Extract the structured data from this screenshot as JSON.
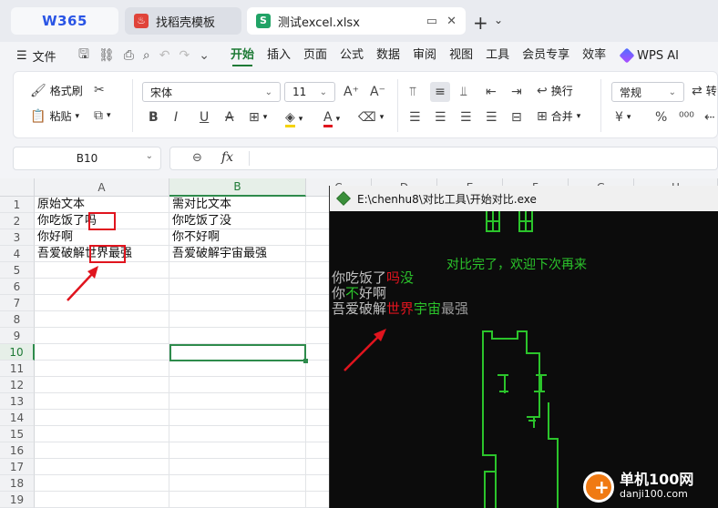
{
  "tabs": [
    {
      "label": "W365"
    },
    {
      "label": "找稻壳模板"
    },
    {
      "label": "测试excel.xlsx"
    }
  ],
  "menu": {
    "file_label": "文件",
    "items": [
      "开始",
      "插入",
      "页面",
      "公式",
      "数据",
      "审阅",
      "视图",
      "工具",
      "会员专享",
      "效率"
    ],
    "active_item": "开始",
    "ai_label": "WPS AI"
  },
  "ribbon": {
    "format_painter": "格式刷",
    "paste": "粘贴",
    "font_name": "宋体",
    "font_size": "11",
    "wrap_text": "换行",
    "merge": "合并",
    "number_format": "常规",
    "convert_label": "转"
  },
  "formula_bar": {
    "cell_ref": "B10",
    "fx_label": "fx",
    "value": ""
  },
  "sheet": {
    "columns": [
      "A",
      "B",
      "C",
      "D",
      "E",
      "F",
      "G",
      "H"
    ],
    "rows": [
      "1",
      "2",
      "3",
      "4",
      "5",
      "6",
      "7",
      "8",
      "9",
      "10",
      "11",
      "12",
      "13",
      "14",
      "15",
      "16",
      "17",
      "18",
      "19"
    ],
    "cells": {
      "A1": "原始文本",
      "B1": "需对比文本",
      "A2": "你吃饭了吗",
      "B2": "你吃饭了没",
      "A3": "你好啊",
      "B3": "你不好啊",
      "A4": "吾爱破解世界最强",
      "B4": "吾爱破解宇宙最强"
    },
    "selected_cell": "B10"
  },
  "console": {
    "title": "E:\\chenhu8\\对比工具\\开始对比.exe",
    "message": "对比完了，欢迎下次再来",
    "line1": {
      "prefix": "你吃饭了",
      "removed": "吗",
      "added": "没"
    },
    "line2": {
      "prefix": "你",
      "added": "不",
      "suffix": "好啊"
    },
    "line3": {
      "prefix": "吾爱破解",
      "removed": "世界",
      "added": "宇宙",
      "suffix": "最强"
    }
  },
  "watermark": {
    "name": "单机100网",
    "url": "danji100.com"
  },
  "colors": {
    "accent_green": "#1e7a36",
    "diff_red": "#e0141e",
    "diff_green": "#2bc42b",
    "annotation_red": "#e0141e"
  }
}
